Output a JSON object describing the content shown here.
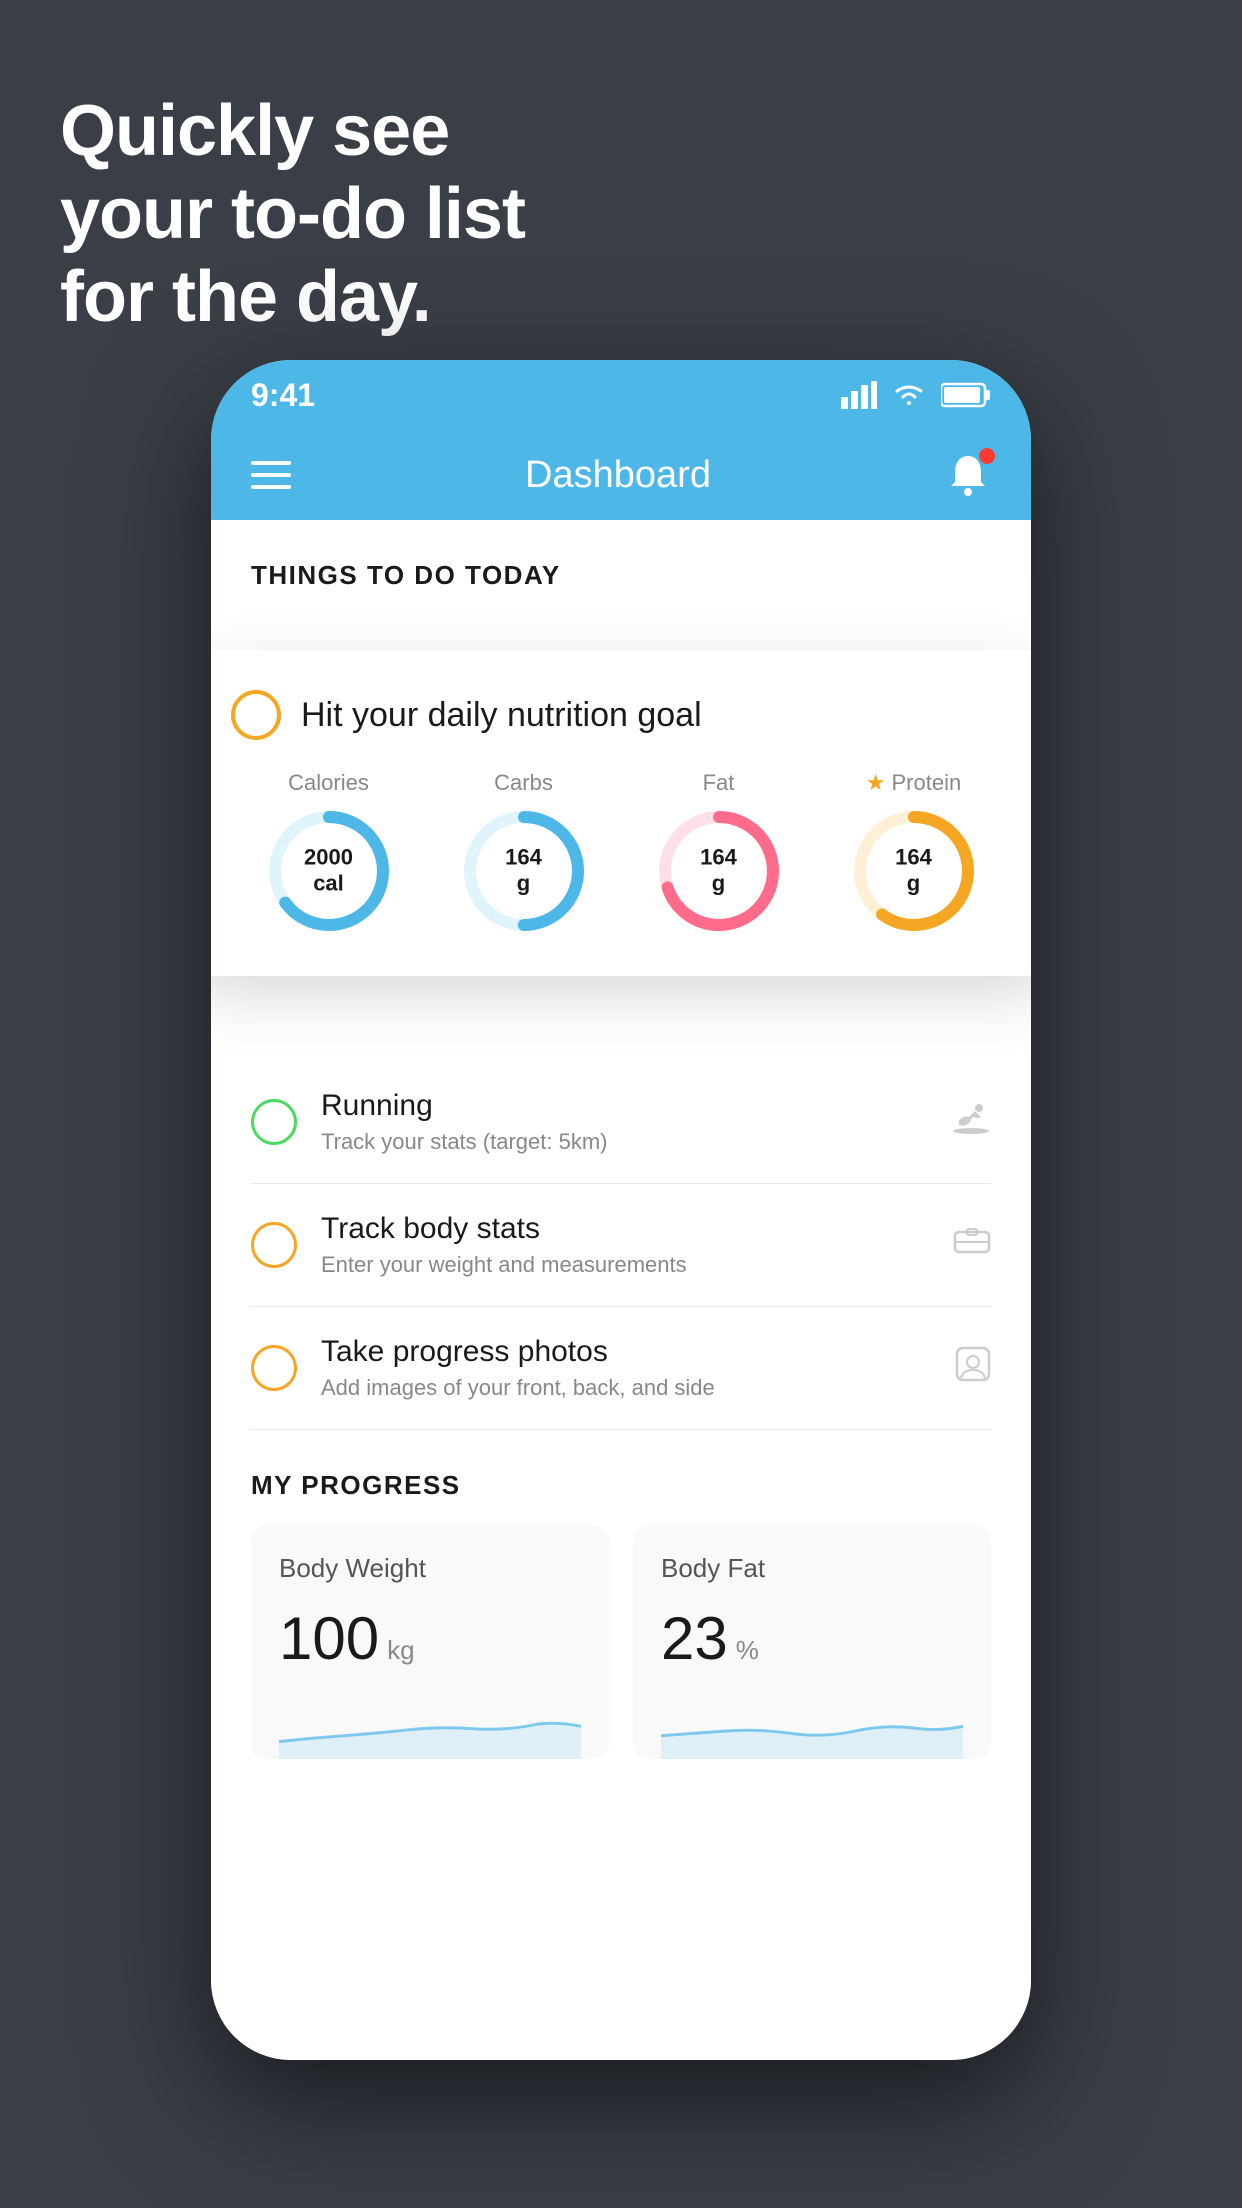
{
  "hero": {
    "line1": "Quickly see",
    "line2": "your to-do list",
    "line3": "for the day."
  },
  "status_bar": {
    "time": "9:41",
    "signal": "▐▐▐▐",
    "wifi": "wifi",
    "battery": "battery"
  },
  "nav": {
    "title": "Dashboard"
  },
  "things_label": "THINGS TO DO TODAY",
  "nutrition_card": {
    "title": "Hit your daily nutrition goal",
    "items": [
      {
        "label": "Calories",
        "value": "2000",
        "unit": "cal",
        "color": "#4db8e8",
        "track_color": "#e0f4fc",
        "percent": 65
      },
      {
        "label": "Carbs",
        "value": "164",
        "unit": "g",
        "color": "#4db8e8",
        "track_color": "#e0f4fc",
        "percent": 50
      },
      {
        "label": "Fat",
        "value": "164",
        "unit": "g",
        "color": "#ff6b8a",
        "track_color": "#ffe0e8",
        "percent": 70
      },
      {
        "label": "Protein",
        "value": "164",
        "unit": "g",
        "color": "#f5a623",
        "track_color": "#fef0d6",
        "percent": 60,
        "starred": true
      }
    ]
  },
  "todo_items": [
    {
      "title": "Running",
      "subtitle": "Track your stats (target: 5km)",
      "circle_color": "green",
      "icon": "🥾"
    },
    {
      "title": "Track body stats",
      "subtitle": "Enter your weight and measurements",
      "circle_color": "yellow",
      "icon": "⚖️"
    },
    {
      "title": "Take progress photos",
      "subtitle": "Add images of your front, back, and side",
      "circle_color": "yellow",
      "icon": "👤"
    }
  ],
  "progress": {
    "label": "MY PROGRESS",
    "cards": [
      {
        "title": "Body Weight",
        "value": "100",
        "unit": "kg"
      },
      {
        "title": "Body Fat",
        "value": "23",
        "unit": "%"
      }
    ]
  }
}
